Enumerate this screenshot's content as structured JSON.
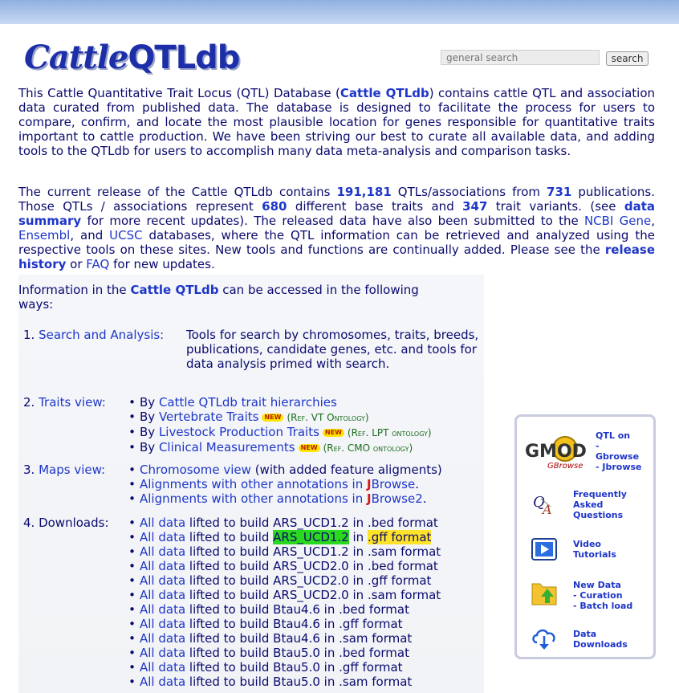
{
  "header": {
    "logo_part1": "Cattle",
    "logo_part2": "QTLdb",
    "search_placeholder": "general search",
    "search_button": "search"
  },
  "intro": {
    "t1": "This Cattle Quantitative Trait Locus (QTL) Database (",
    "link": "Cattle QTLdb",
    "t2": ") contains cattle QTL and association data curated from published data. The database is designed to facilitate the process for users to compare, confirm, and locate the most plausible location for genes responsible for quantitative traits important to cattle production. We have been striving our best to curate all available data, and adding tools to the QTLdb for users to accomplish many data meta-analysis and comparison tasks."
  },
  "release": {
    "t1": "The current release of the Cattle QTLdb contains ",
    "qtl_count": "191,181",
    "t2": " QTLs/associations from ",
    "pub_count": "731",
    "t3": " publications. Those QTLs / associations represent ",
    "trait_count": "680",
    "t4": " different base traits and ",
    "variant_count": "347",
    "t5": " trait variants. (see ",
    "data_summary": "data summary",
    "t6": " for more recent updates). The released data have also been submitted to the ",
    "ncbi": "NCBI Gene",
    "t7": ", ",
    "ensembl": "Ensembl",
    "t8": ", and ",
    "ucsc": "UCSC",
    "t9": " databases, where the QTL information can be retrieved and analyzed using the respective tools on these sites. New tools and functions are continually added. Please see the ",
    "release_history": "release history",
    "t10": " or ",
    "faq": "FAQ",
    "t11": " for new updates."
  },
  "access": {
    "t1": "Information in the ",
    "link": "Cattle QTLdb",
    "t2": " can be accessed in the following ways:",
    "s1_num": "1. ",
    "s1_label": "Search and Analysis:",
    "s1_desc": "Tools for search by chromosomes, traits, breeds, publications, candidate genes, etc. and tools for data analysis primed with search.",
    "s2_num": "2. ",
    "s2_label": "Traits view:",
    "s3_num": "3. ",
    "s3_label": "Maps view:",
    "s4_label": "4. Downloads:",
    "by": "By ",
    "trait_hier": "Cattle QTLdb trait hierarchies",
    "vert": "Vertebrate Traits",
    "vert_ref": "(Ref. VT Ontology)",
    "live": "Livestock Production Traits",
    "live_ref": "(Ref. LPT ontology)",
    "clin": "Clinical Measurements",
    "clin_ref": "(Ref. CMO ontology)",
    "new_badge": "NEW",
    "chrom_view": "Chromosome view",
    "chrom_suffix": " (with added feature aligments)",
    "align": "Alignments with other annotations in ",
    "jbrowse_j": "J",
    "jbrowse_rest": "Browse",
    "jbrowse2_rest": "Browse2",
    "period": ".",
    "all_data": "All data",
    "lifted": " lifted to build ",
    "in_word": " in ",
    "downloads": [
      {
        "build": "ARS_UCD1.2",
        "format": ".bed format"
      },
      {
        "build": "ARS_UCD1.2",
        "format": ".gff format"
      },
      {
        "build": "ARS_UCD1.2",
        "format": ".sam format"
      },
      {
        "build": "ARS_UCD2.0",
        "format": ".bed format"
      },
      {
        "build": "ARS_UCD2.0",
        "format": ".gff format"
      },
      {
        "build": "ARS_UCD2.0",
        "format": ".sam format"
      },
      {
        "build": "Btau4.6",
        "format": ".bed format"
      },
      {
        "build": "Btau4.6",
        "format": ".gff format"
      },
      {
        "build": "Btau4.6",
        "format": ".sam format"
      },
      {
        "build": "Btau5.0",
        "format": ".bed format"
      },
      {
        "build": "Btau5.0",
        "format": ".gff format"
      },
      {
        "build": "Btau5.0",
        "format": ".sam format"
      }
    ]
  },
  "sidebar": {
    "gmod_label": "GMOD",
    "gbrowse_small": "GBrowse",
    "qtl_on": "QTL on",
    "dash": "-",
    "gbrowse": "Gbrowse",
    "jbrowse": "- Jbrowse",
    "faq1": "Frequently",
    "faq2": "Asked",
    "faq3": "Questions",
    "video1": "Video",
    "video2": "Tutorials",
    "new1": "New Data",
    "new2": "- Curation",
    "new3": "- Batch load",
    "dl1": "Data",
    "dl2": "Downloads"
  },
  "colors": {
    "text": "#0a0a6e",
    "link": "#1e36c8",
    "highlight_green": "#2ad81e",
    "highlight_yellow": "#ffe22a"
  }
}
